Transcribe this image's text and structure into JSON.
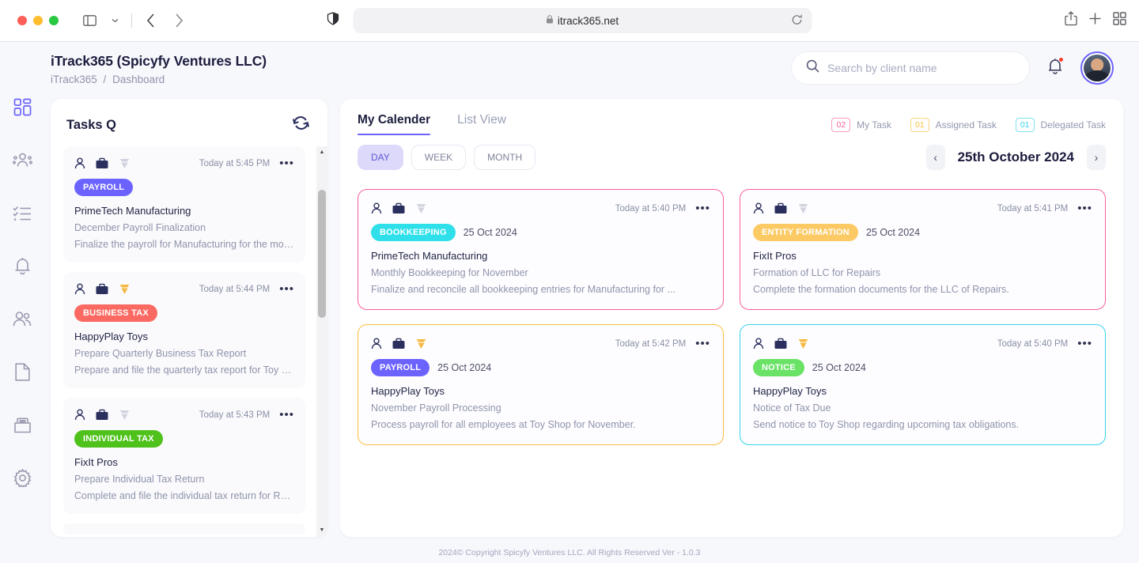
{
  "browser": {
    "url": "itrack365.net",
    "lock_icon": "lock-icon",
    "shield_icon": "shield-icon",
    "reload_icon": "reload-icon",
    "sidebar_toggle_icon": "sidebar-toggle-icon",
    "back_icon": "back-arrow-icon",
    "forward_icon": "forward-arrow-icon",
    "share_icon": "share-icon",
    "new_tab_icon": "plus-icon",
    "tab_overview_icon": "tab-overview-icon"
  },
  "header": {
    "title": "iTrack365 (Spicyfy Ventures LLC)",
    "breadcrumb_root": "iTrack365",
    "breadcrumb_sep": "/",
    "breadcrumb_current": "Dashboard",
    "search_placeholder": "Search by client name",
    "search_value": "",
    "search_icon": "search-icon",
    "bell_icon": "bell-icon",
    "avatar": "user-avatar"
  },
  "sidebar": {
    "items": [
      {
        "name": "dashboard",
        "icon": "grid-icon",
        "active": true
      },
      {
        "name": "team",
        "icon": "team-icon",
        "active": false
      },
      {
        "name": "tasks",
        "icon": "checklist-icon",
        "active": false
      },
      {
        "name": "notifications",
        "icon": "bell-icon",
        "active": false
      },
      {
        "name": "clients",
        "icon": "users-icon",
        "active": false
      },
      {
        "name": "documents",
        "icon": "document-icon",
        "active": false
      },
      {
        "name": "archive",
        "icon": "archive-box-icon",
        "active": false
      },
      {
        "name": "settings",
        "icon": "gear-icon",
        "active": false
      }
    ]
  },
  "tasks_panel": {
    "title": "Tasks Q",
    "refresh_icon": "refresh-icon",
    "scrollbar": {
      "up_icon": "▲",
      "down_icon": "▼"
    },
    "cards": [
      {
        "badge": "PAYROLL",
        "badge_color": "#6c63ff",
        "time": "Today at 5:45 PM",
        "client": "PrimeTech Manufacturing",
        "subtitle": "December Payroll Finalization",
        "description": "Finalize the payroll for Manufacturing for the month of ...",
        "gem": "off"
      },
      {
        "badge": "BUSINESS TAX",
        "badge_color": "#fa6a62",
        "time": "Today at 5:44 PM",
        "client": "HappyPlay Toys",
        "subtitle": "Prepare Quarterly Business Tax Report",
        "description": "Prepare and file the quarterly tax report for Toy Shop.",
        "gem": "on"
      },
      {
        "badge": "INDIVIDUAL TAX",
        "badge_color": "#4fc11b",
        "time": "Today at 5:43 PM",
        "client": "FixIt Pros",
        "subtitle": "Prepare Individual Tax Return",
        "description": "Complete and file the individual tax return for Repairs' ...",
        "gem": "off"
      }
    ]
  },
  "calendar": {
    "tabs": [
      {
        "label": "My Calender",
        "active": true
      },
      {
        "label": "List View",
        "active": false
      }
    ],
    "legend": [
      {
        "count": "02",
        "label": "My Task",
        "color": "#fb5f9b"
      },
      {
        "count": "01",
        "label": "Assigned Task",
        "color": "#fbbf3f"
      },
      {
        "count": "01",
        "label": "Delegated Task",
        "color": "#35d2ec"
      }
    ],
    "view_toggles": [
      {
        "label": "DAY",
        "active": true
      },
      {
        "label": "WEEK",
        "active": false
      },
      {
        "label": "MONTH",
        "active": false
      }
    ],
    "prev_icon": "‹",
    "next_icon": "›",
    "date_label": "25th October 2024",
    "events": [
      {
        "badge": "BOOKKEEPING",
        "badge_color": "#2fe0ea",
        "border_color": "#fb5f9b",
        "time": "Today at 5:40 PM",
        "date": "25 Oct 2024",
        "client": "PrimeTech Manufacturing",
        "subtitle": "Monthly Bookkeeping for November",
        "description": "Finalize and reconcile all bookkeeping entries for Manufacturing for ...",
        "gem": "off"
      },
      {
        "badge": "ENTITY FORMATION",
        "badge_color": "#fcca65",
        "border_color": "#fb5f9b",
        "time": "Today at 5:41 PM",
        "date": "25 Oct 2024",
        "client": "FixIt Pros",
        "subtitle": "Formation of LLC for Repairs",
        "description": "Complete the formation documents for the LLC of Repairs.",
        "gem": "off"
      },
      {
        "badge": "PAYROLL",
        "badge_color": "#6c63ff",
        "border_color": "#fbbf3f",
        "time": "Today at 5:42 PM",
        "date": "25 Oct 2024",
        "client": "HappyPlay Toys",
        "subtitle": "November Payroll Processing",
        "description": "Process payroll for all employees at Toy Shop for November.",
        "gem": "on"
      },
      {
        "badge": "NOTICE",
        "badge_color": "#69e265",
        "border_color": "#35d2ec",
        "time": "Today at 5:40 PM",
        "date": "25 Oct 2024",
        "client": "HappyPlay Toys",
        "subtitle": "Notice of Tax Due",
        "description": "Send notice to Toy Shop regarding upcoming tax obligations.",
        "gem": "on"
      }
    ]
  },
  "footer": {
    "text": "2024© Copyright Spicyfy Ventures LLC. All Rights Reserved  Ver - 1.0.3"
  }
}
